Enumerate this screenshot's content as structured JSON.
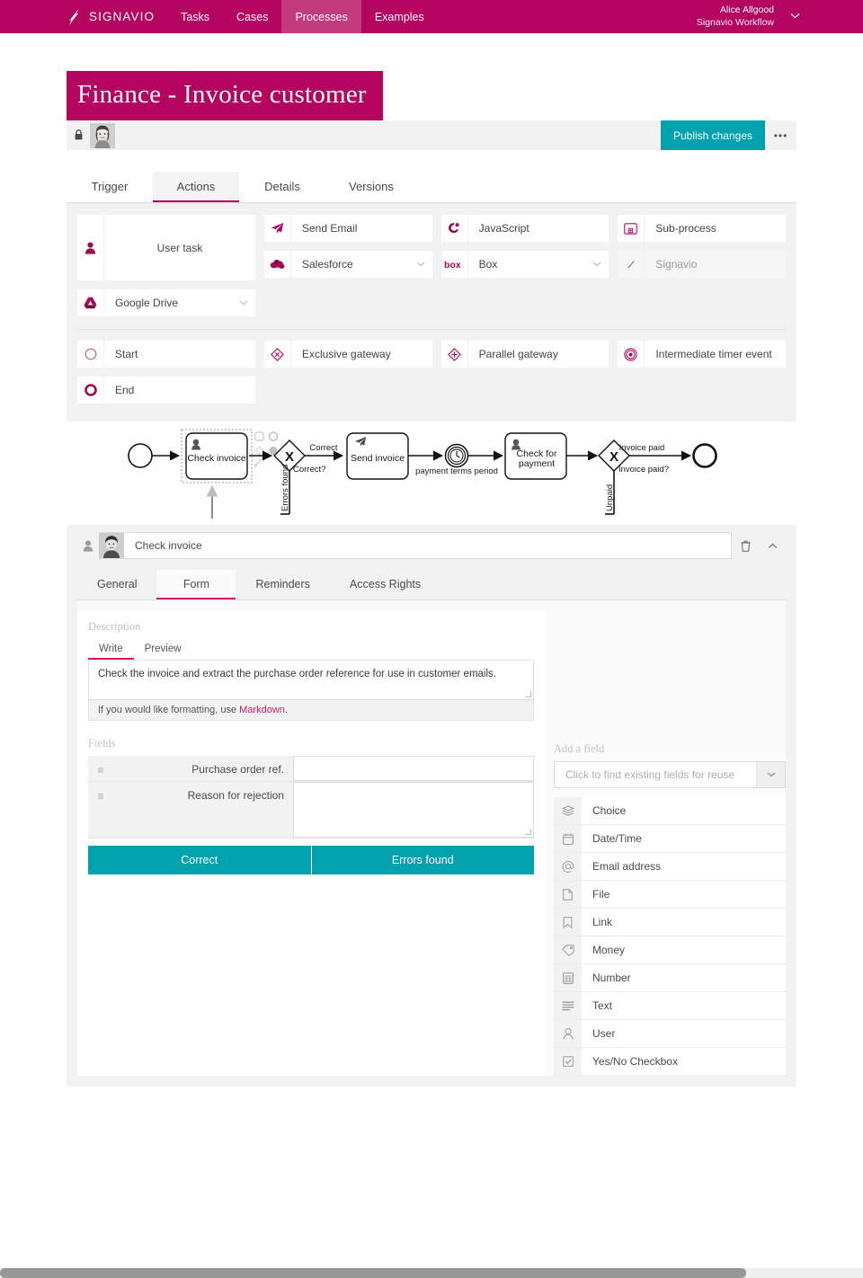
{
  "topnav": {
    "brand": "SIGNAVIO",
    "brand_logo_icon": "signavio-logo-icon",
    "items": [
      {
        "label": "Tasks",
        "active": false
      },
      {
        "label": "Cases",
        "active": false
      },
      {
        "label": "Processes",
        "active": true
      },
      {
        "label": "Examples",
        "active": false
      }
    ],
    "user": {
      "name": "Alice Allgood",
      "org": "Signavio Workflow",
      "caret_icon": "chevron-down-icon"
    },
    "bg_color": "#b4045f",
    "active_bg_color": "#c43a7e"
  },
  "header": {
    "title": "Finance - Invoice customer",
    "lock_icon": "lock-icon",
    "avatar_icon": "avatar-image",
    "publish_label": "Publish changes",
    "more_icon": "ellipsis-icon",
    "accent_color": "#b4045f",
    "publish_color": "#00a3ad"
  },
  "tabs": [
    {
      "label": "Trigger",
      "active": false
    },
    {
      "label": "Actions",
      "active": true
    },
    {
      "label": "Details",
      "active": false
    },
    {
      "label": "Versions",
      "active": false
    }
  ],
  "palette": {
    "user_task": {
      "label": "User task",
      "icon": "user-task-icon"
    },
    "google_drive": {
      "label": "Google Drive",
      "icon": "google-drive-icon",
      "has_caret": true
    },
    "column2": [
      {
        "label": "Send Email",
        "icon": "send-email-icon",
        "has_caret": false
      },
      {
        "label": "Salesforce",
        "icon": "salesforce-icon",
        "has_caret": true
      }
    ],
    "column3": [
      {
        "label": "JavaScript",
        "icon": "javascript-icon",
        "has_caret": false
      },
      {
        "label": "Box",
        "icon": "box-icon",
        "has_caret": true
      }
    ],
    "column4": [
      {
        "label": "Sub-process",
        "icon": "sub-process-icon",
        "has_caret": false
      },
      {
        "label": "Signavio",
        "icon": "signavio-wrench-icon",
        "has_caret": false,
        "muted": true
      }
    ],
    "events": {
      "col1": [
        {
          "label": "Start",
          "icon": "start-event-icon"
        },
        {
          "label": "End",
          "icon": "end-event-icon"
        }
      ],
      "col2": [
        {
          "label": "Exclusive gateway",
          "icon": "exclusive-gateway-icon"
        }
      ],
      "col3": [
        {
          "label": "Parallel gateway",
          "icon": "parallel-gateway-icon"
        }
      ],
      "col4": [
        {
          "label": "Intermediate timer event",
          "icon": "timer-event-icon"
        }
      ]
    }
  },
  "diagram": {
    "nodes": [
      {
        "id": "start",
        "type": "start-event",
        "label": ""
      },
      {
        "id": "check-invoice",
        "type": "user-task",
        "label": "Check invoice",
        "selected": true
      },
      {
        "id": "gateway-correct",
        "type": "exclusive-gateway",
        "label": "Correct?"
      },
      {
        "id": "send-invoice",
        "type": "send-task",
        "label": "Send invoice"
      },
      {
        "id": "timer",
        "type": "timer-event",
        "label": "payment terms period"
      },
      {
        "id": "check-payment",
        "type": "user-task",
        "label": "Check for payment"
      },
      {
        "id": "gateway-paid",
        "type": "exclusive-gateway",
        "label": "Invoice paid?"
      },
      {
        "id": "end",
        "type": "end-event",
        "label": ""
      }
    ],
    "flow_labels": [
      "Correct",
      "Errors found",
      "Invoice paid",
      "Unpaid"
    ],
    "context_icons": [
      "task-shape-icon",
      "event-shape-icon",
      "gateway-shape-icon",
      "end-shape-icon",
      "connect-tool-icon"
    ]
  },
  "properties": {
    "header": {
      "type_icon": "user-task-icon",
      "avatar_icon": "avatar-image",
      "title": "Check invoice",
      "delete_icon": "trash-icon",
      "collapse_icon": "chevron-up-icon"
    },
    "tabs": [
      {
        "label": "General",
        "active": false
      },
      {
        "label": "Form",
        "active": true
      },
      {
        "label": "Reminders",
        "active": false
      },
      {
        "label": "Access Rights",
        "active": false
      }
    ],
    "description": {
      "section_label": "Description",
      "write_tab": "Write",
      "preview_tab": "Preview",
      "text": "Check the invoice and extract the purchase order reference for use in customer emails.",
      "hint_prefix": "If you would like formatting, use ",
      "hint_link": "Markdown",
      "hint_suffix": "."
    },
    "fields": {
      "section_label": "Fields",
      "handle_icon": "drag-handle-icon",
      "rows": [
        {
          "label": "Purchase order ref.",
          "value": "",
          "multiline": false
        },
        {
          "label": "Reason for rejection",
          "value": "",
          "multiline": true
        }
      ],
      "buttons": [
        {
          "label": "Correct"
        },
        {
          "label": "Errors found"
        }
      ]
    },
    "add_field": {
      "section_label": "Add a field",
      "placeholder": "Click to find existing fields for reuse",
      "caret_icon": "chevron-down-icon",
      "types": [
        {
          "label": "Choice",
          "icon": "choice-icon"
        },
        {
          "label": "Date/Time",
          "icon": "calendar-icon"
        },
        {
          "label": "Email address",
          "icon": "at-sign-icon"
        },
        {
          "label": "File",
          "icon": "file-icon"
        },
        {
          "label": "Link",
          "icon": "bookmark-icon"
        },
        {
          "label": "Money",
          "icon": "money-icon"
        },
        {
          "label": "Number",
          "icon": "number-grid-icon"
        },
        {
          "label": "Text",
          "icon": "text-lines-icon"
        },
        {
          "label": "User",
          "icon": "user-icon"
        },
        {
          "label": "Yes/No Checkbox",
          "icon": "checkbox-icon"
        }
      ]
    }
  },
  "scrollbar": {
    "orientation": "horizontal"
  }
}
